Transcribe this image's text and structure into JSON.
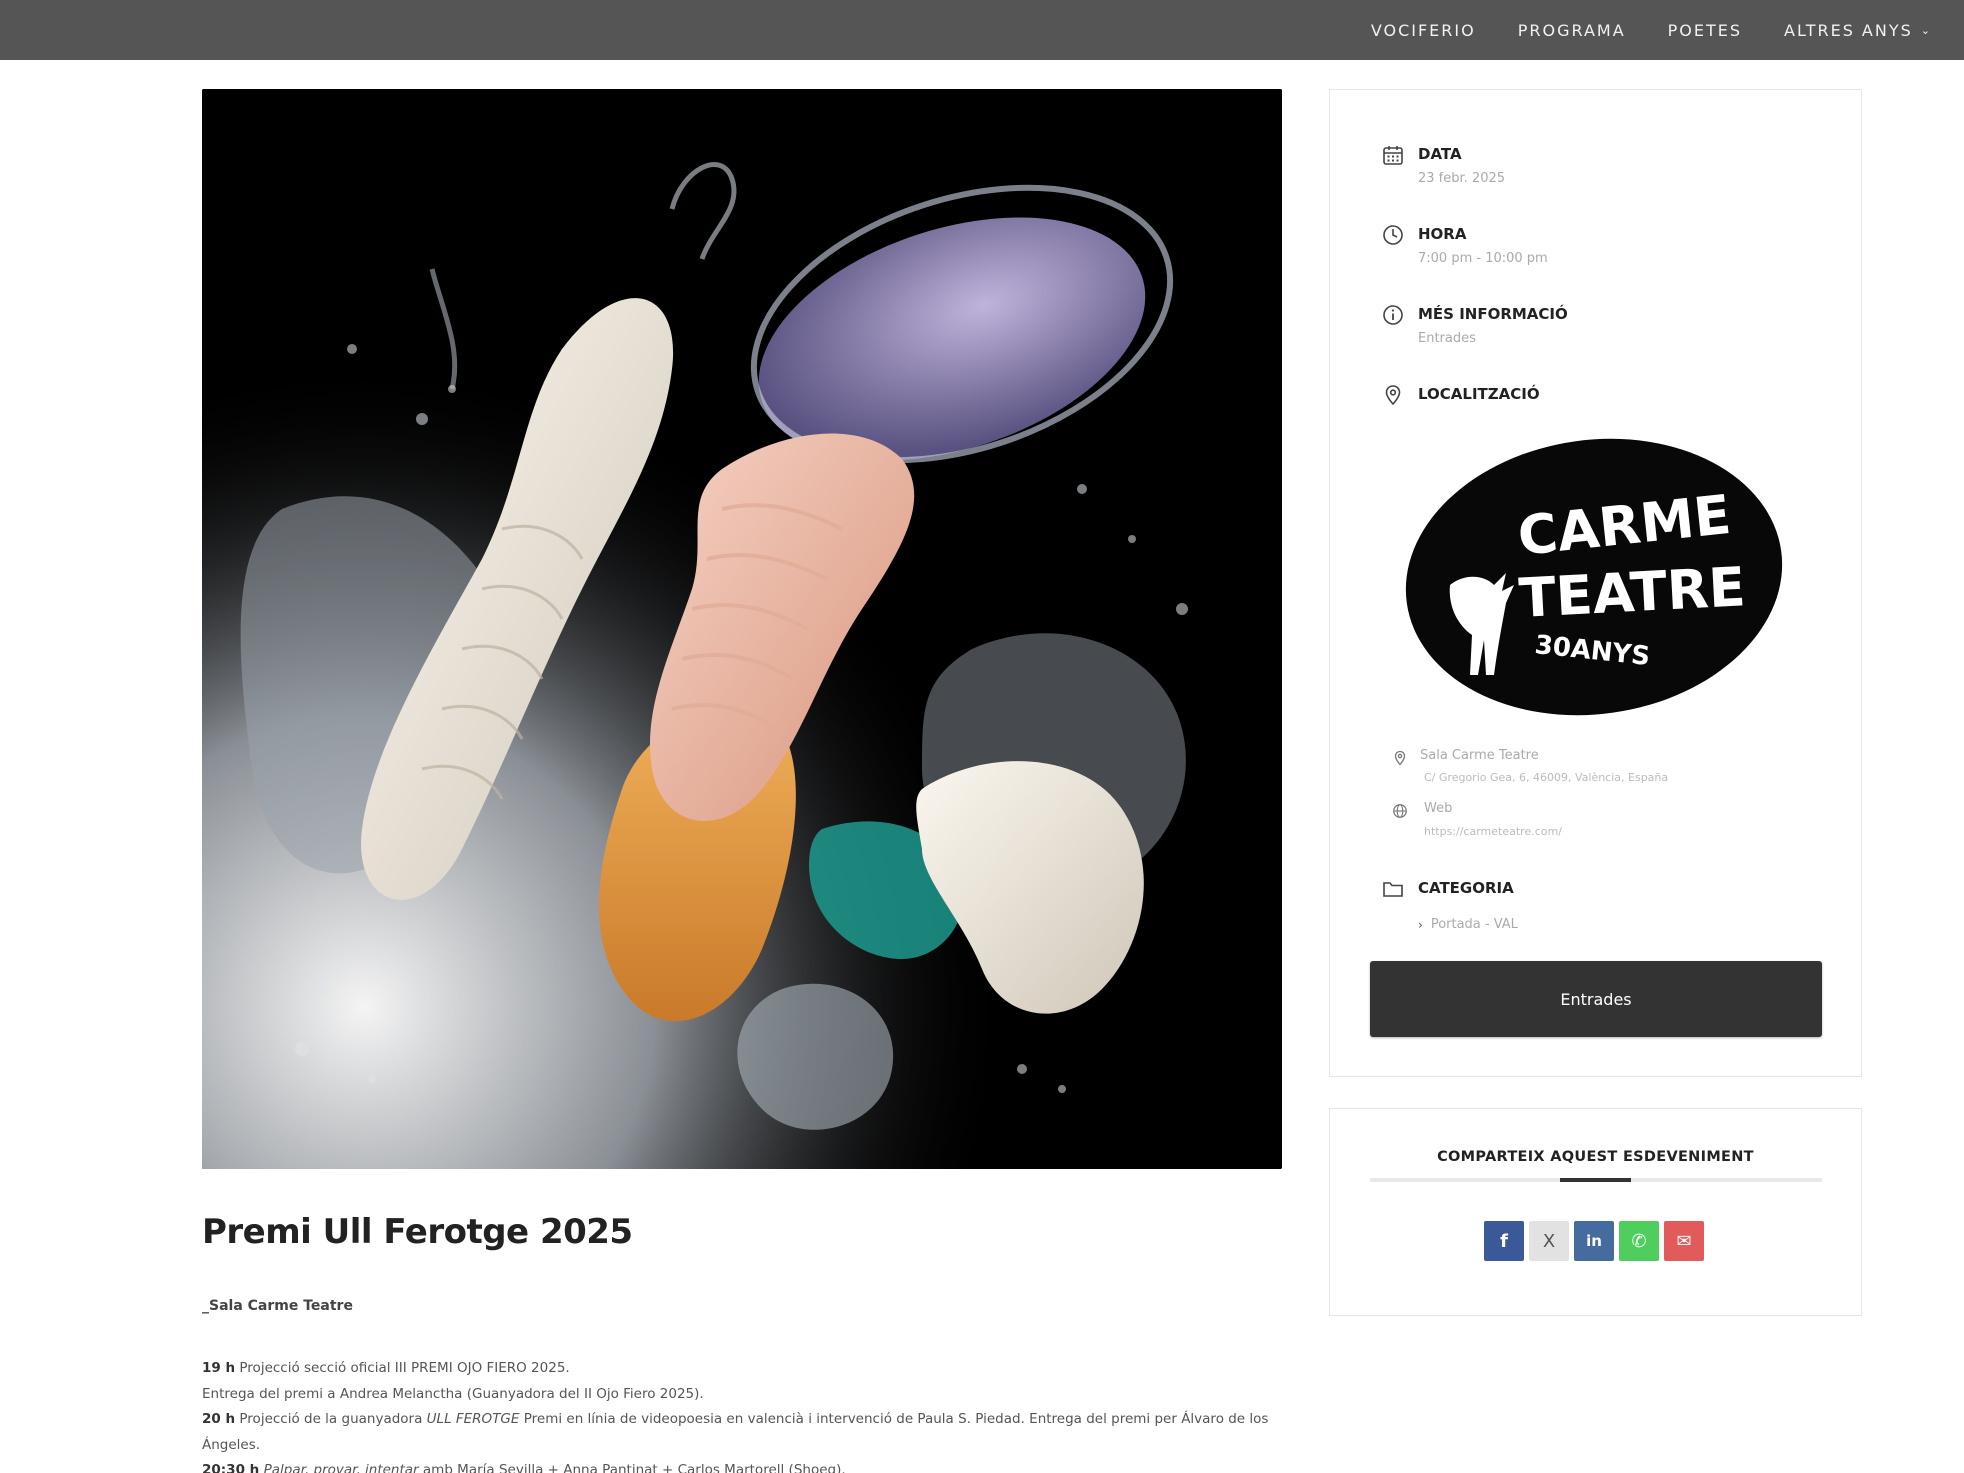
{
  "nav": {
    "items": [
      {
        "label": "VOCIFERIO"
      },
      {
        "label": "PROGRAMA"
      },
      {
        "label": "POETES"
      },
      {
        "label": "ALTRES ANYS",
        "has_dropdown": true
      }
    ]
  },
  "event": {
    "title": "Premi Ull Ferotge 2025",
    "venue_line": "_Sala Carme Teatre",
    "program": [
      {
        "time": "19 h",
        "parts": [
          {
            "text": " Projecció secció oficial III PREMI OJO FIERO 2025.",
            "italic": false
          }
        ]
      },
      {
        "time": "",
        "parts": [
          {
            "text": "Entrega del premi a Andrea Melanctha (Guanyadora del II Ojo Fiero 2025).",
            "italic": false
          }
        ]
      },
      {
        "time": "20 h",
        "parts": [
          {
            "text": " Projecció de la guanyadora ",
            "italic": false
          },
          {
            "text": "ULL FEROTGE",
            "italic": true
          },
          {
            "text": " Premi en línia de videopoesia en valencià i intervenció de Paula S. Piedad. Entrega del premi per Álvaro de los Ángeles.",
            "italic": false
          }
        ]
      },
      {
        "time": "20:30 h",
        "parts": [
          {
            "text": " ",
            "italic": false
          },
          {
            "text": "Palpar, provar, intentar",
            "italic": true
          },
          {
            "text": " amb María Sevilla + Anna Pantinat + Carlos Martorell (Shoeg).",
            "italic": false
          }
        ]
      }
    ]
  },
  "info": {
    "date_label": "DATA",
    "date_value": "23 febr. 2025",
    "time_label": "HORA",
    "time_value": "7:00 pm - 10:00 pm",
    "more_label": "MÉS INFORMACIÓ",
    "more_value": "Entrades",
    "location_label": "LOCALITZACIÓ",
    "logo_text": [
      "CARME",
      "TEATRE",
      "30ANYS"
    ],
    "venue_name": "Sala Carme Teatre",
    "venue_address": "C/ Gregorio Gea, 6, 46009, València, España",
    "web_label": "Web",
    "web_url": "https://carmeteatre.com/",
    "category_label": "CATEGORIA",
    "category_value": "Portada - VAL",
    "tickets_button": "Entrades"
  },
  "share": {
    "title": "COMPARTEIX AQUEST ESDEVENIMENT",
    "buttons": [
      {
        "name": "facebook",
        "glyph": "f",
        "color": "#3b5998"
      },
      {
        "name": "x",
        "glyph": "X",
        "color": "#e2e2e2"
      },
      {
        "name": "linkedin",
        "glyph": "in",
        "color": "#466b9e"
      },
      {
        "name": "whatsapp",
        "glyph": "✆",
        "color": "#4fce5d"
      },
      {
        "name": "email",
        "glyph": "✉",
        "color": "#e25b5b"
      }
    ]
  }
}
